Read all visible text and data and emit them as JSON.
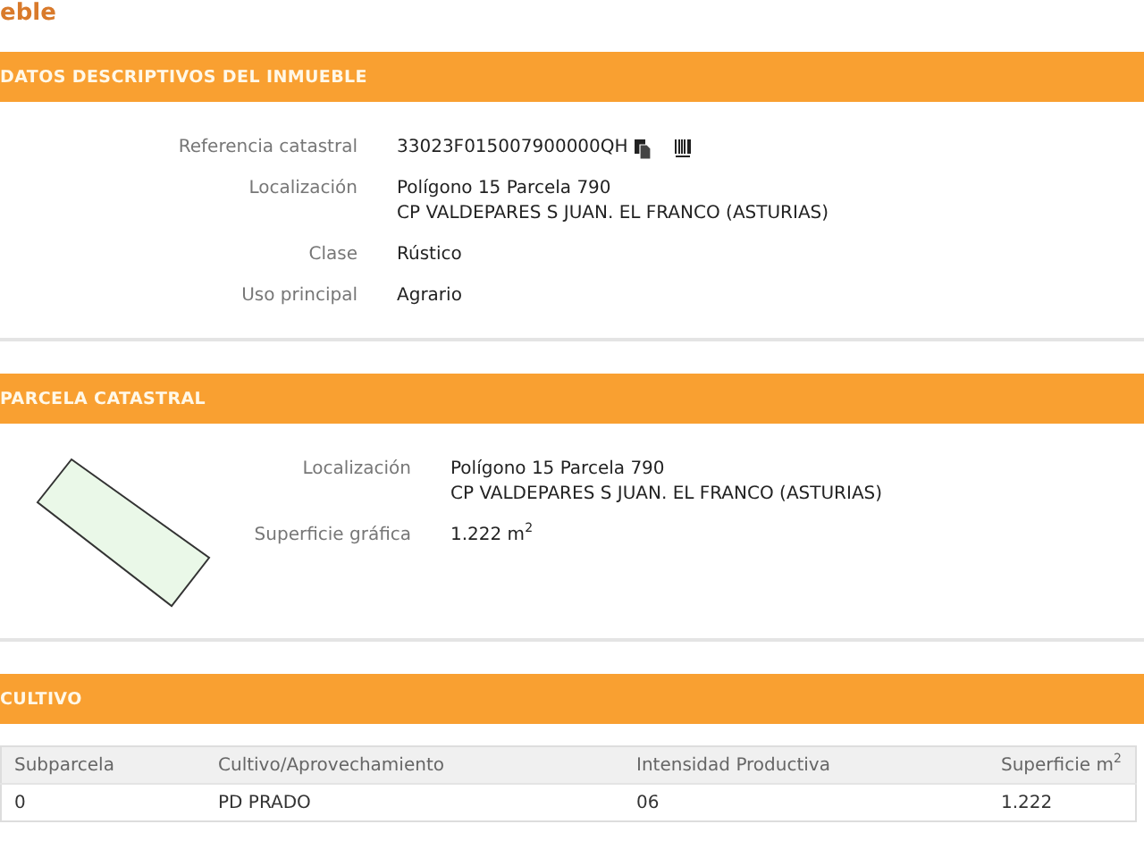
{
  "title": "eble",
  "sections": [
    {
      "kind": "fields",
      "heading": "DATOS DESCRIPTIVOS DEL INMUEBLE",
      "fields": [
        {
          "label": "Referencia catastral",
          "lines": [
            "33023F015007900000QH"
          ],
          "kind": "reference"
        },
        {
          "label": "Localización",
          "lines": [
            "Polígono 15 Parcela 790",
            "CP VALDEPARES S JUAN. EL FRANCO (ASTURIAS)"
          ]
        },
        {
          "label": "Clase",
          "lines": [
            "Rústico"
          ]
        },
        {
          "label": "Uso principal",
          "lines": [
            "Agrario"
          ]
        }
      ]
    },
    {
      "kind": "parcel",
      "heading": "PARCELA CATASTRAL",
      "fields": [
        {
          "label": "Localización",
          "lines": [
            "Polígono 15 Parcela 790",
            "CP VALDEPARES S JUAN. EL FRANCO (ASTURIAS)"
          ]
        },
        {
          "label": "Superficie gráfica",
          "lines": [
            "1.222 m$^{2}$"
          ]
        }
      ]
    },
    {
      "kind": "table",
      "heading": "CULTIVO",
      "columns": [
        "Subparcela",
        "Cultivo/Aprovechamiento",
        "Intensidad Productiva",
        "Superficie m$^{2}$"
      ],
      "rows": [
        [
          "0",
          "PD PRADO",
          "06",
          "1.222"
        ]
      ]
    }
  ]
}
